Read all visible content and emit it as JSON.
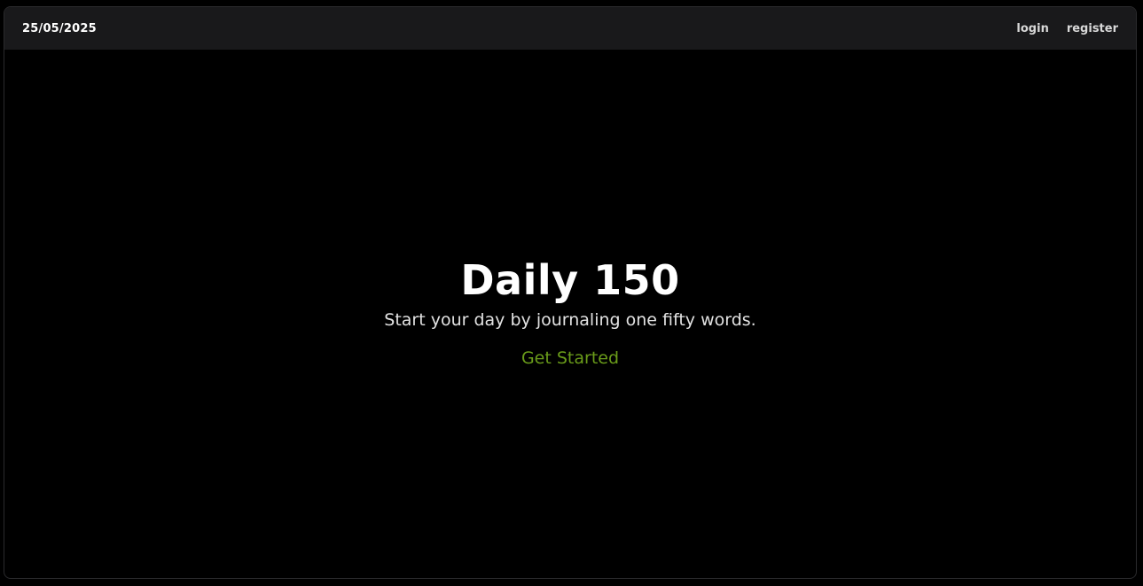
{
  "header": {
    "date": "25/05/2025",
    "nav": {
      "login": "login",
      "register": "register"
    }
  },
  "hero": {
    "title": "Daily 150",
    "subtitle": "Start your day by journaling one fifty words.",
    "cta": "Get Started"
  },
  "colors": {
    "background": "#000000",
    "topbar": "#19191b",
    "accent": "#6a9c1a",
    "text": "#ffffff"
  }
}
